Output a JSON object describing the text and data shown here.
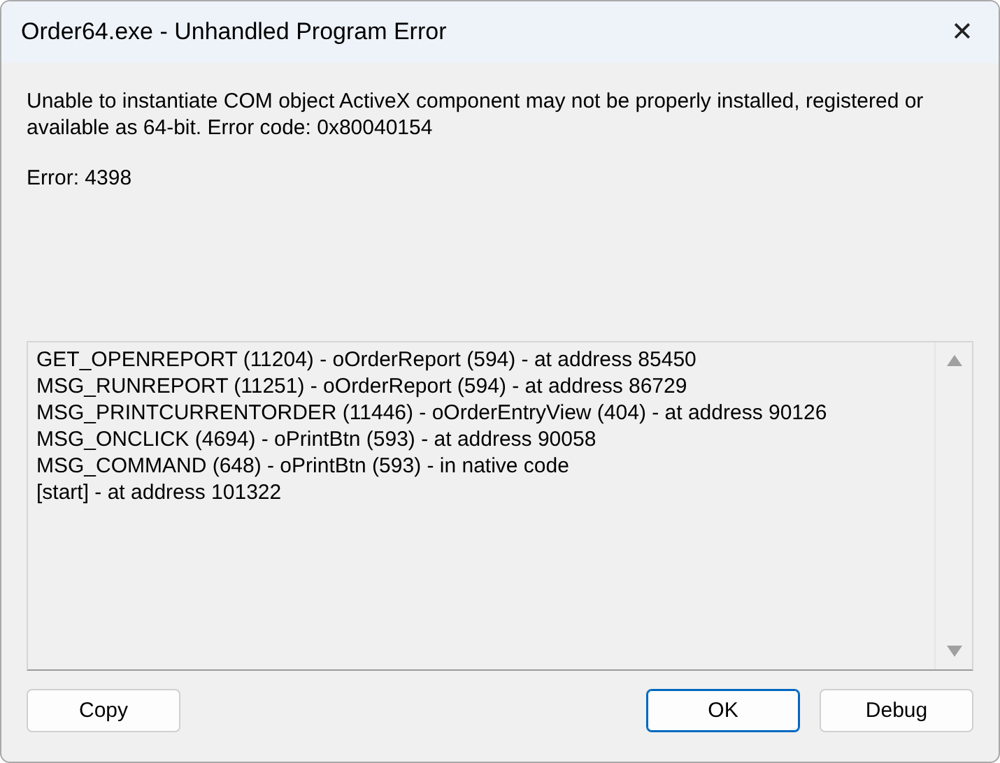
{
  "window": {
    "title": "Order64.exe - Unhandled Program Error",
    "close": "✕"
  },
  "message": "Unable to instantiate COM object ActiveX component may not be properly installed, registered or available as 64-bit. Error code: 0x80040154",
  "error": "Error: 4398",
  "stack_trace": [
    "GET_OPENREPORT (11204) - oOrderReport (594) - at address 85450",
    "MSG_RUNREPORT (11251) - oOrderReport (594) - at address 86729",
    "MSG_PRINTCURRENTORDER (11446) - oOrderEntryView (404) - at address 90126",
    "MSG_ONCLICK (4694) - oPrintBtn (593) - at address 90058",
    "MSG_COMMAND (648) - oPrintBtn (593) - in native code",
    "[start] - at address 101322"
  ],
  "buttons": [
    {
      "label": "Copy",
      "default": false
    },
    {
      "label": "OK",
      "default": true
    },
    {
      "label": "Debug",
      "default": false
    }
  ]
}
